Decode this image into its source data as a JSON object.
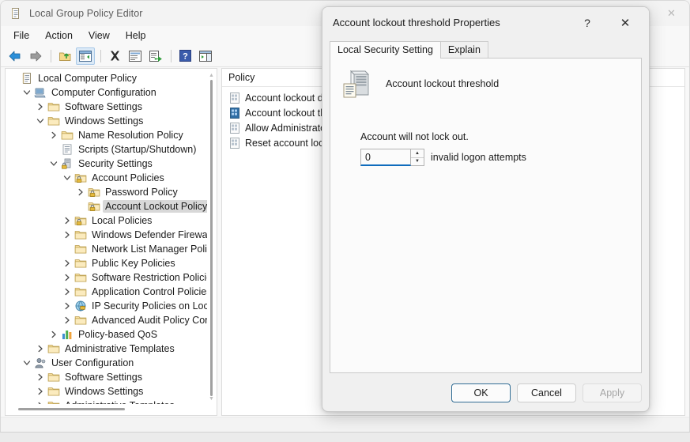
{
  "window": {
    "title": "Local Group Policy Editor",
    "icon": "policy-scroll-icon",
    "controls": {
      "minimize": "–",
      "maximize": "☐",
      "close": "✕"
    }
  },
  "menubar": {
    "items": [
      {
        "label": "File"
      },
      {
        "label": "Action"
      },
      {
        "label": "View"
      },
      {
        "label": "Help"
      }
    ]
  },
  "toolbar": {
    "buttons": [
      {
        "name": "back-button",
        "icon": "back-arrow-icon"
      },
      {
        "name": "forward-button",
        "icon": "forward-arrow-icon"
      },
      {
        "name": "up-one-level-button",
        "icon": "up-folder-icon"
      },
      {
        "name": "show-hide-tree-button",
        "icon": "console-tree-icon"
      },
      {
        "name": "delete-button",
        "icon": "delete-x-icon"
      },
      {
        "name": "properties-button",
        "icon": "properties-icon"
      },
      {
        "name": "export-list-button",
        "icon": "export-list-icon"
      },
      {
        "name": "help-button",
        "icon": "help-question-icon"
      },
      {
        "name": "view-button",
        "icon": "view-pane-icon"
      }
    ]
  },
  "tree": {
    "nodes": [
      {
        "label": "Local Computer Policy",
        "indent": 0,
        "expander": "none",
        "icon": "policy-scroll-icon",
        "selected": false
      },
      {
        "label": "Computer Configuration",
        "indent": 1,
        "expander": "expanded",
        "icon": "computer-icon",
        "selected": false
      },
      {
        "label": "Software Settings",
        "indent": 2,
        "expander": "collapsed",
        "icon": "folder-icon",
        "selected": false
      },
      {
        "label": "Windows Settings",
        "indent": 2,
        "expander": "expanded",
        "icon": "folder-icon",
        "selected": false
      },
      {
        "label": "Name Resolution Policy",
        "indent": 3,
        "expander": "collapsed",
        "icon": "folder-icon",
        "selected": false
      },
      {
        "label": "Scripts (Startup/Shutdown)",
        "indent": 3,
        "expander": "none",
        "icon": "script-icon",
        "selected": false
      },
      {
        "label": "Security Settings",
        "indent": 3,
        "expander": "expanded",
        "icon": "security-lock-icon",
        "selected": false
      },
      {
        "label": "Account Policies",
        "indent": 4,
        "expander": "expanded",
        "icon": "folder-lock-icon",
        "selected": false
      },
      {
        "label": "Password Policy",
        "indent": 5,
        "expander": "collapsed",
        "icon": "folder-lock-icon",
        "selected": false
      },
      {
        "label": "Account Lockout Policy",
        "indent": 5,
        "expander": "none",
        "icon": "folder-lock-icon",
        "selected": true
      },
      {
        "label": "Local Policies",
        "indent": 4,
        "expander": "collapsed",
        "icon": "folder-lock-icon",
        "selected": false
      },
      {
        "label": "Windows Defender Firewall w",
        "indent": 4,
        "expander": "collapsed",
        "icon": "folder-icon",
        "selected": false
      },
      {
        "label": "Network List Manager Policie",
        "indent": 4,
        "expander": "none",
        "icon": "folder-icon",
        "selected": false
      },
      {
        "label": "Public Key Policies",
        "indent": 4,
        "expander": "collapsed",
        "icon": "folder-icon",
        "selected": false
      },
      {
        "label": "Software Restriction Policies",
        "indent": 4,
        "expander": "collapsed",
        "icon": "folder-icon",
        "selected": false
      },
      {
        "label": "Application Control Policies",
        "indent": 4,
        "expander": "collapsed",
        "icon": "folder-icon",
        "selected": false
      },
      {
        "label": "IP Security Policies on Local ",
        "indent": 4,
        "expander": "collapsed",
        "icon": "ip-security-icon",
        "selected": false
      },
      {
        "label": "Advanced Audit Policy Confi",
        "indent": 4,
        "expander": "collapsed",
        "icon": "folder-icon",
        "selected": false
      },
      {
        "label": "Policy-based QoS",
        "indent": 3,
        "expander": "collapsed",
        "icon": "qos-chart-icon",
        "selected": false
      },
      {
        "label": "Administrative Templates",
        "indent": 2,
        "expander": "collapsed",
        "icon": "folder-icon",
        "selected": false
      },
      {
        "label": "User Configuration",
        "indent": 1,
        "expander": "expanded",
        "icon": "user-icon",
        "selected": false
      },
      {
        "label": "Software Settings",
        "indent": 2,
        "expander": "collapsed",
        "icon": "folder-icon",
        "selected": false
      },
      {
        "label": "Windows Settings",
        "indent": 2,
        "expander": "collapsed",
        "icon": "folder-icon",
        "selected": false
      },
      {
        "label": "Administrative Templates",
        "indent": 2,
        "expander": "collapsed",
        "icon": "folder-icon",
        "selected": false
      }
    ]
  },
  "list": {
    "column_header": "Policy",
    "rows": [
      {
        "label": "Account lockout du",
        "icon": "policy-setting-icon",
        "selected": false
      },
      {
        "label": "Account lockout thr",
        "icon": "policy-setting-icon",
        "selected": true
      },
      {
        "label": "Allow Administrator",
        "icon": "policy-setting-icon",
        "selected": false
      },
      {
        "label": "Reset account locko",
        "icon": "policy-setting-icon",
        "selected": false
      }
    ]
  },
  "dialog": {
    "title": "Account lockout threshold Properties",
    "help_glyph": "?",
    "close_glyph": "✕",
    "tabs": [
      {
        "label": "Local Security Setting",
        "active": true
      },
      {
        "label": "Explain",
        "active": false
      }
    ],
    "policy_icon": "server-policy-icon",
    "policy_name": "Account lockout threshold",
    "setting_note": "Account will not lock out.",
    "spin_value": "0",
    "spin_up_glyph": "▲",
    "spin_down_glyph": "▼",
    "spin_suffix": "invalid logon attempts",
    "buttons": [
      {
        "label": "OK",
        "name": "ok-button",
        "style": "default"
      },
      {
        "label": "Cancel",
        "name": "cancel-button",
        "style": "normal"
      },
      {
        "label": "Apply",
        "name": "apply-button",
        "style": "disabled"
      }
    ]
  },
  "colors": {
    "accent": "#0f6cbd",
    "selection": "#d8d8d8",
    "window_bg": "#f3f3f3",
    "pane_bg": "#ffffff"
  }
}
